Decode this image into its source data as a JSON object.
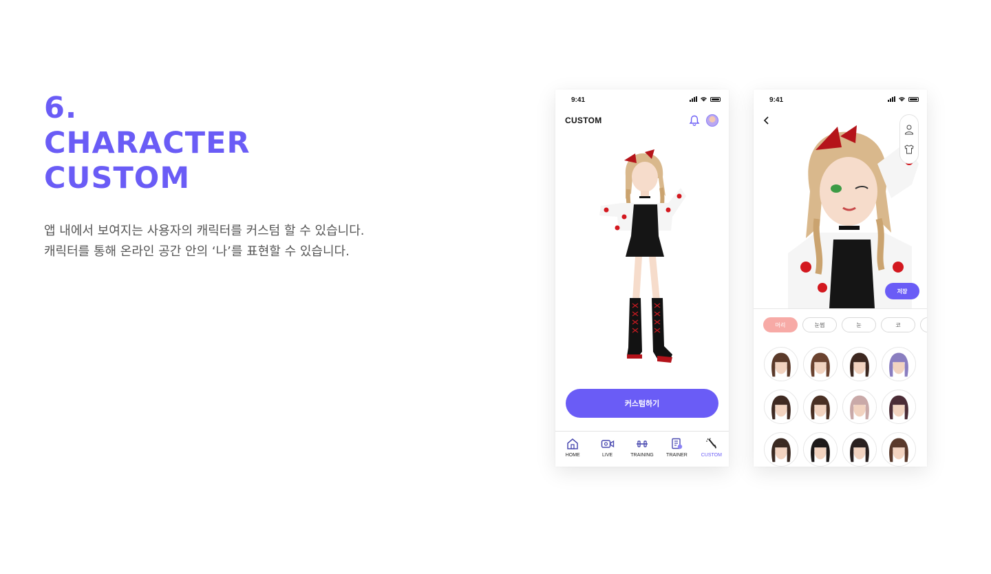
{
  "heading": {
    "number": "6.",
    "line1": "CHARACTER",
    "line2": "CUSTOM"
  },
  "description": {
    "line1": "앱 내에서 보여지는 사용자의 캐릭터를 커스텀 할 수 있습니다.",
    "line2": "캐릭터를 통해 온라인 공간 안의 ‘나’를 표현할 수 있습니다."
  },
  "colors": {
    "accent": "#6a5cf6",
    "chip_active": "#f7aaa6"
  },
  "phone1": {
    "status_time": "9:41",
    "title": "CUSTOM",
    "cta_label": "커스텀하기",
    "tabs": [
      {
        "label": "HOME",
        "icon": "home-icon"
      },
      {
        "label": "LIVE",
        "icon": "video-icon"
      },
      {
        "label": "TRAINING",
        "icon": "dumbbell-icon"
      },
      {
        "label": "TRAINER",
        "icon": "trainer-icon"
      },
      {
        "label": "CUSTOM",
        "icon": "brush-icon"
      }
    ],
    "active_tab": "CUSTOM"
  },
  "phone2": {
    "status_time": "9:41",
    "save_label": "저장",
    "categories": [
      "머리",
      "눈썹",
      "눈",
      "코"
    ],
    "active_category": "머리",
    "hair_item_count": 12
  }
}
